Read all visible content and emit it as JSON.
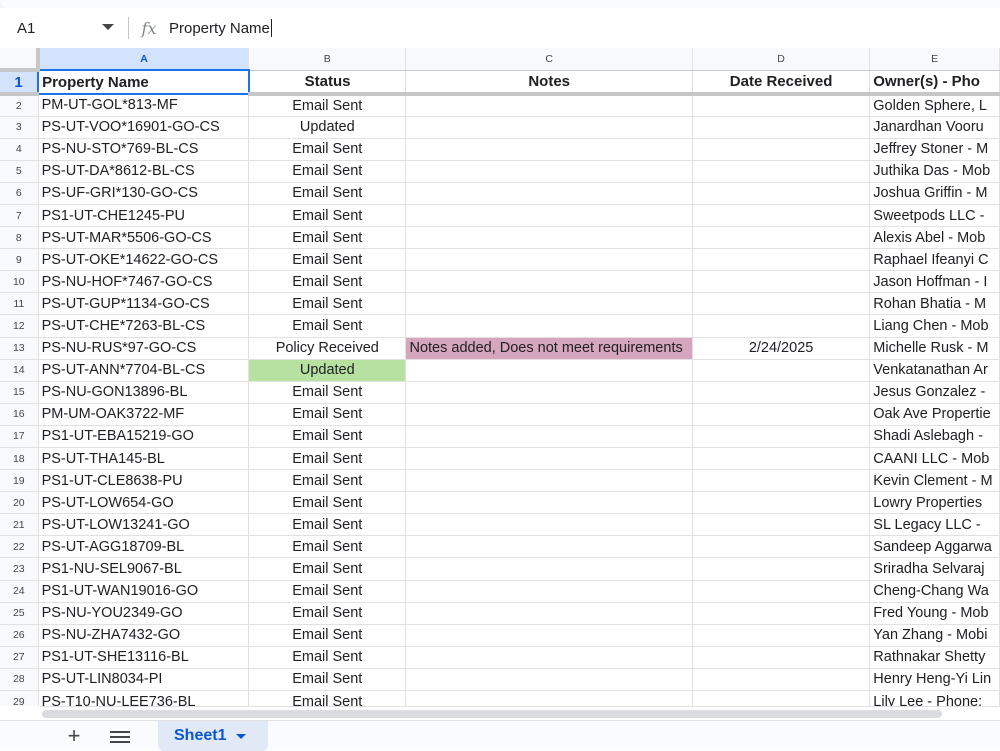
{
  "formula_bar": {
    "cell_ref": "A1",
    "fx_symbol": "fx",
    "content": "Property Name"
  },
  "columns": [
    "",
    "A",
    "B",
    "C",
    "D",
    "E"
  ],
  "header_row": {
    "num": "1",
    "cells": [
      "Property Name",
      "Status",
      "Notes",
      "Date Received",
      "Owner(s) - Pho"
    ]
  },
  "rows": [
    {
      "num": "2",
      "cells": [
        "PM-UT-GOL*813-MF",
        "Email Sent",
        "",
        "",
        "Golden Sphere, L"
      ]
    },
    {
      "num": "3",
      "cells": [
        "PS-UT-VOO*16901-GO-CS",
        "Updated",
        "",
        "",
        "Janardhan Vooru"
      ]
    },
    {
      "num": "4",
      "cells": [
        "PS-NU-STO*769-BL-CS",
        "Email Sent",
        "",
        "",
        "Jeffrey Stoner - M"
      ]
    },
    {
      "num": "5",
      "cells": [
        "PS-UT-DA*8612-BL-CS",
        "Email Sent",
        "",
        "",
        "Juthika Das - Mob"
      ]
    },
    {
      "num": "6",
      "cells": [
        "PS-UF-GRI*130-GO-CS",
        "Email Sent",
        "",
        "",
        "Joshua Griffin - M"
      ]
    },
    {
      "num": "7",
      "cells": [
        "PS1-UT-CHE1245-PU",
        "Email Sent",
        "",
        "",
        "Sweetpods LLC -"
      ]
    },
    {
      "num": "8",
      "cells": [
        "PS-UT-MAR*5506-GO-CS",
        "Email Sent",
        "",
        "",
        "Alexis Abel - Mob"
      ]
    },
    {
      "num": "9",
      "cells": [
        "PS-UT-OKE*14622-GO-CS",
        "Email Sent",
        "",
        "",
        "Raphael Ifeanyi C"
      ]
    },
    {
      "num": "10",
      "cells": [
        "PS-NU-HOF*7467-GO-CS",
        "Email Sent",
        "",
        "",
        "Jason Hoffman - I"
      ]
    },
    {
      "num": "11",
      "cells": [
        "PS-UT-GUP*1134-GO-CS",
        "Email Sent",
        "",
        "",
        "Rohan Bhatia - M"
      ]
    },
    {
      "num": "12",
      "cells": [
        "PS-UT-CHE*7263-BL-CS",
        "Email Sent",
        "",
        "",
        "Liang Chen - Mob"
      ]
    },
    {
      "num": "13",
      "cells": [
        "PS-NU-RUS*97-GO-CS",
        "Policy Received",
        "Notes added, Does not meet requirements",
        "2/24/2025",
        "Michelle Rusk - M"
      ]
    },
    {
      "num": "14",
      "cells": [
        "PS-UT-ANN*7704-BL-CS",
        "Updated",
        "",
        "",
        "Venkatanathan Ar"
      ]
    },
    {
      "num": "15",
      "cells": [
        "PS-NU-GON13896-BL",
        "Email Sent",
        "",
        "",
        "Jesus Gonzalez -"
      ]
    },
    {
      "num": "16",
      "cells": [
        "PM-UM-OAK3722-MF",
        "Email Sent",
        "",
        "",
        "Oak Ave Propertie"
      ]
    },
    {
      "num": "17",
      "cells": [
        "PS1-UT-EBA15219-GO",
        "Email Sent",
        "",
        "",
        "Shadi Aslebagh -"
      ]
    },
    {
      "num": "18",
      "cells": [
        "PS-UT-THA145-BL",
        "Email Sent",
        "",
        "",
        "CAANI LLC - Mob"
      ]
    },
    {
      "num": "19",
      "cells": [
        "PS1-UT-CLE8638-PU",
        "Email Sent",
        "",
        "",
        "Kevin Clement - M"
      ]
    },
    {
      "num": "20",
      "cells": [
        "PS-UT-LOW654-GO",
        "Email Sent",
        "",
        "",
        "Lowry Properties"
      ]
    },
    {
      "num": "21",
      "cells": [
        "PS-UT-LOW13241-GO",
        "Email Sent",
        "",
        "",
        "SL Legacy LLC -"
      ]
    },
    {
      "num": "22",
      "cells": [
        "PS-UT-AGG18709-BL",
        "Email Sent",
        "",
        "",
        "Sandeep Aggarwa"
      ]
    },
    {
      "num": "23",
      "cells": [
        "PS1-NU-SEL9067-BL",
        "Email Sent",
        "",
        "",
        "Sriradha Selvaraj"
      ]
    },
    {
      "num": "24",
      "cells": [
        "PS1-UT-WAN19016-GO",
        "Email Sent",
        "",
        "",
        "Cheng-Chang Wa"
      ]
    },
    {
      "num": "25",
      "cells": [
        "PS-NU-YOU2349-GO",
        "Email Sent",
        "",
        "",
        "Fred Young - Mob"
      ]
    },
    {
      "num": "26",
      "cells": [
        "PS-NU-ZHA7432-GO",
        "Email Sent",
        "",
        "",
        "Yan Zhang - Mobi"
      ]
    },
    {
      "num": "27",
      "cells": [
        "PS1-UT-SHE13116-BL",
        "Email Sent",
        "",
        "",
        "Rathnakar Shetty"
      ]
    },
    {
      "num": "28",
      "cells": [
        "PS-UT-LIN8034-PI",
        "Email Sent",
        "",
        "",
        "Henry Heng-Yi Lin"
      ]
    },
    {
      "num": "29",
      "cells": [
        "PS-T10-NU-LEE736-BL",
        "Email Sent",
        "",
        "",
        "Lily Lee - Phone:"
      ]
    }
  ],
  "cell_fills": {
    "green": "#b7e1a1",
    "pink": "#d5a6bd"
  },
  "highlights": {
    "green_cell": "14:B",
    "pink_cell": "13:C"
  },
  "sheet_tabs": {
    "add_icon": "+",
    "active_tab": "Sheet1"
  }
}
